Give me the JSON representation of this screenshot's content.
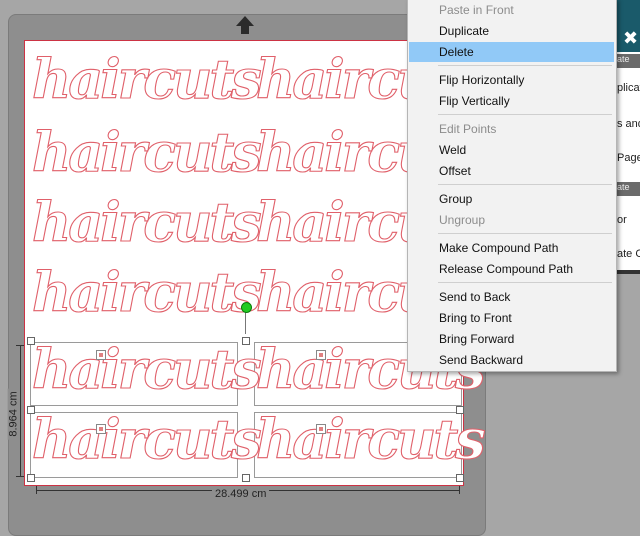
{
  "canvas": {
    "repeated_text": "haircuts",
    "width_dimension": "28.499 cm",
    "height_dimension": "8.964 cm"
  },
  "context_menu": {
    "items": [
      {
        "label": "Paste in Front",
        "disabled": true
      },
      {
        "label": "Duplicate",
        "disabled": false
      },
      {
        "label": "Delete",
        "disabled": false,
        "highlighted": true
      },
      {
        "label": "Flip Horizontally",
        "disabled": false
      },
      {
        "label": "Flip Vertically",
        "disabled": false
      },
      {
        "label": "Edit Points",
        "disabled": true
      },
      {
        "label": "Weld",
        "disabled": false
      },
      {
        "label": "Offset",
        "disabled": false
      },
      {
        "label": "Group",
        "disabled": false
      },
      {
        "label": "Ungroup",
        "disabled": true
      },
      {
        "label": "Make Compound Path",
        "disabled": false
      },
      {
        "label": "Release Compound Path",
        "disabled": false
      },
      {
        "label": "Send to Back",
        "disabled": false
      },
      {
        "label": "Bring to Front",
        "disabled": false
      },
      {
        "label": "Bring Forward",
        "disabled": false
      },
      {
        "label": "Send Backward",
        "disabled": false
      }
    ]
  },
  "side_panel": {
    "strip_1": "ate",
    "text_1": "plicate",
    "text_2": "s and",
    "text_3": "Page",
    "strip_2": "ate",
    "text_4": "or",
    "text_5": "ate Co"
  },
  "colors": {
    "cut_line": "#e0606a",
    "menu_highlight": "#91c9f7",
    "panel_header": "#1a5a6a",
    "rotate_handle": "#22cc22"
  }
}
